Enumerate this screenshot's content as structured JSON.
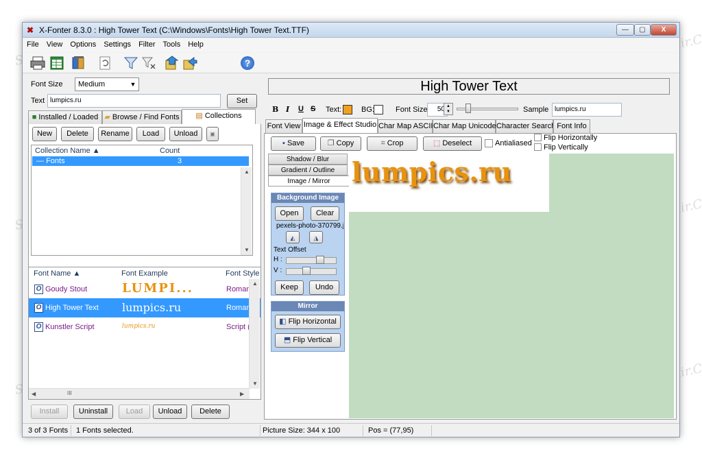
{
  "window": {
    "title": "X-Fonter 8.3.0 : High Tower Text (C:\\Windows\\Fonts\\High Tower Text.TTF)",
    "min": "0",
    "max": "1",
    "close": "X"
  },
  "menu": [
    "File",
    "View",
    "Options",
    "Settings",
    "Filter",
    "Tools",
    "Help"
  ],
  "toolbar": {
    "help": "?"
  },
  "font_size": {
    "label": "Font Size",
    "value": "Medium"
  },
  "text": {
    "label": "Text",
    "value": "lumpics.ru",
    "set": "Set"
  },
  "left_tabs": [
    "Installed / Loaded",
    "Browse / Find Fonts",
    "Collections"
  ],
  "collection_buttons": [
    "New",
    "Delete",
    "Rename",
    "Load",
    "Unload"
  ],
  "collections": {
    "headers": [
      "Collection Name",
      "Count"
    ],
    "rows": [
      {
        "name": "Fonts",
        "count": "3"
      }
    ]
  },
  "font_list": {
    "headers": [
      "Font Name",
      "Font Example",
      "Font Style"
    ],
    "rows": [
      {
        "name": "Goudy Stout",
        "example": "LUMPI...",
        "style": "Roman"
      },
      {
        "name": "High Tower Text",
        "example": "lumpics.ru",
        "style": "Roman"
      },
      {
        "name": "Kunstler Script",
        "example": "lumpics.ru",
        "style": "Script ("
      }
    ]
  },
  "bottom_buttons": [
    "Install",
    "Uninstall",
    "Load",
    "Unload",
    "Delete"
  ],
  "preview": {
    "font_name": "High Tower Text",
    "bold": "B",
    "italic": "I",
    "underline": "U",
    "strike": "S",
    "text_label": "Text:",
    "bg_label": "BG:",
    "text_color": "#f0a020",
    "bg_color": "#ffffff",
    "font_size_label": "Font Size",
    "font_size_value": "50",
    "sample_label": "Sample",
    "sample_value": "lumpics.ru"
  },
  "right_tabs": [
    "Font View",
    "Image & Effect Studio",
    "Char Map ASCII",
    "Char Map Unicode",
    "Character Search",
    "Font Info"
  ],
  "studio_toolbar": {
    "save": "Save",
    "copy": "Copy",
    "crop": "Crop",
    "deselect": "Deselect",
    "antialiased": "Antialiased",
    "flip_h": "Flip Horizontally",
    "flip_v": "Flip Vertically"
  },
  "side_tabs": [
    "Shadow / Blur",
    "Gradient / Outline",
    "Image / Mirror"
  ],
  "background_image": {
    "title": "Background Image",
    "open": "Open",
    "clear": "Clear",
    "file": "pexels-photo-370799.j",
    "text_offset": "Text Offset",
    "h_label": "H :",
    "v_label": "V :",
    "keep": "Keep",
    "undo": "Undo"
  },
  "mirror": {
    "title": "Mirror",
    "flip_horizontal": "Flip Horizontal",
    "flip_vertical": "Flip Vertical"
  },
  "canvas": {
    "sample_text": "lumpics.ru"
  },
  "status": {
    "count": "3 of 3 Fonts",
    "selected": "1 Fonts selected.",
    "picture_size": "Picture Size: 344 x 100",
    "pos": "Pos = (77,95)"
  },
  "scroll": {
    "grip": "III"
  },
  "watermark": "Soringpcrepair.Com"
}
